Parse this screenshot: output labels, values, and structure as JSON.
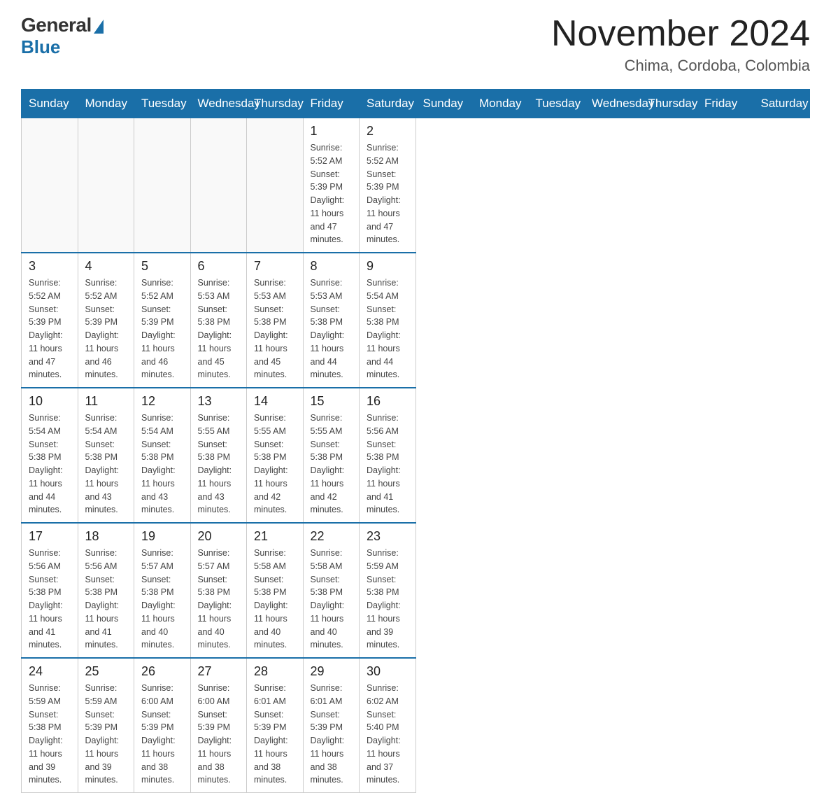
{
  "header": {
    "logo": {
      "general": "General",
      "blue": "Blue"
    },
    "title": "November 2024",
    "location": "Chima, Cordoba, Colombia"
  },
  "days_of_week": [
    "Sunday",
    "Monday",
    "Tuesday",
    "Wednesday",
    "Thursday",
    "Friday",
    "Saturday"
  ],
  "weeks": [
    [
      {
        "day": "",
        "info": ""
      },
      {
        "day": "",
        "info": ""
      },
      {
        "day": "",
        "info": ""
      },
      {
        "day": "",
        "info": ""
      },
      {
        "day": "",
        "info": ""
      },
      {
        "day": "1",
        "info": "Sunrise: 5:52 AM\nSunset: 5:39 PM\nDaylight: 11 hours\nand 47 minutes."
      },
      {
        "day": "2",
        "info": "Sunrise: 5:52 AM\nSunset: 5:39 PM\nDaylight: 11 hours\nand 47 minutes."
      }
    ],
    [
      {
        "day": "3",
        "info": "Sunrise: 5:52 AM\nSunset: 5:39 PM\nDaylight: 11 hours\nand 47 minutes."
      },
      {
        "day": "4",
        "info": "Sunrise: 5:52 AM\nSunset: 5:39 PM\nDaylight: 11 hours\nand 46 minutes."
      },
      {
        "day": "5",
        "info": "Sunrise: 5:52 AM\nSunset: 5:39 PM\nDaylight: 11 hours\nand 46 minutes."
      },
      {
        "day": "6",
        "info": "Sunrise: 5:53 AM\nSunset: 5:38 PM\nDaylight: 11 hours\nand 45 minutes."
      },
      {
        "day": "7",
        "info": "Sunrise: 5:53 AM\nSunset: 5:38 PM\nDaylight: 11 hours\nand 45 minutes."
      },
      {
        "day": "8",
        "info": "Sunrise: 5:53 AM\nSunset: 5:38 PM\nDaylight: 11 hours\nand 44 minutes."
      },
      {
        "day": "9",
        "info": "Sunrise: 5:54 AM\nSunset: 5:38 PM\nDaylight: 11 hours\nand 44 minutes."
      }
    ],
    [
      {
        "day": "10",
        "info": "Sunrise: 5:54 AM\nSunset: 5:38 PM\nDaylight: 11 hours\nand 44 minutes."
      },
      {
        "day": "11",
        "info": "Sunrise: 5:54 AM\nSunset: 5:38 PM\nDaylight: 11 hours\nand 43 minutes."
      },
      {
        "day": "12",
        "info": "Sunrise: 5:54 AM\nSunset: 5:38 PM\nDaylight: 11 hours\nand 43 minutes."
      },
      {
        "day": "13",
        "info": "Sunrise: 5:55 AM\nSunset: 5:38 PM\nDaylight: 11 hours\nand 43 minutes."
      },
      {
        "day": "14",
        "info": "Sunrise: 5:55 AM\nSunset: 5:38 PM\nDaylight: 11 hours\nand 42 minutes."
      },
      {
        "day": "15",
        "info": "Sunrise: 5:55 AM\nSunset: 5:38 PM\nDaylight: 11 hours\nand 42 minutes."
      },
      {
        "day": "16",
        "info": "Sunrise: 5:56 AM\nSunset: 5:38 PM\nDaylight: 11 hours\nand 41 minutes."
      }
    ],
    [
      {
        "day": "17",
        "info": "Sunrise: 5:56 AM\nSunset: 5:38 PM\nDaylight: 11 hours\nand 41 minutes."
      },
      {
        "day": "18",
        "info": "Sunrise: 5:56 AM\nSunset: 5:38 PM\nDaylight: 11 hours\nand 41 minutes."
      },
      {
        "day": "19",
        "info": "Sunrise: 5:57 AM\nSunset: 5:38 PM\nDaylight: 11 hours\nand 40 minutes."
      },
      {
        "day": "20",
        "info": "Sunrise: 5:57 AM\nSunset: 5:38 PM\nDaylight: 11 hours\nand 40 minutes."
      },
      {
        "day": "21",
        "info": "Sunrise: 5:58 AM\nSunset: 5:38 PM\nDaylight: 11 hours\nand 40 minutes."
      },
      {
        "day": "22",
        "info": "Sunrise: 5:58 AM\nSunset: 5:38 PM\nDaylight: 11 hours\nand 40 minutes."
      },
      {
        "day": "23",
        "info": "Sunrise: 5:59 AM\nSunset: 5:38 PM\nDaylight: 11 hours\nand 39 minutes."
      }
    ],
    [
      {
        "day": "24",
        "info": "Sunrise: 5:59 AM\nSunset: 5:38 PM\nDaylight: 11 hours\nand 39 minutes."
      },
      {
        "day": "25",
        "info": "Sunrise: 5:59 AM\nSunset: 5:39 PM\nDaylight: 11 hours\nand 39 minutes."
      },
      {
        "day": "26",
        "info": "Sunrise: 6:00 AM\nSunset: 5:39 PM\nDaylight: 11 hours\nand 38 minutes."
      },
      {
        "day": "27",
        "info": "Sunrise: 6:00 AM\nSunset: 5:39 PM\nDaylight: 11 hours\nand 38 minutes."
      },
      {
        "day": "28",
        "info": "Sunrise: 6:01 AM\nSunset: 5:39 PM\nDaylight: 11 hours\nand 38 minutes."
      },
      {
        "day": "29",
        "info": "Sunrise: 6:01 AM\nSunset: 5:39 PM\nDaylight: 11 hours\nand 38 minutes."
      },
      {
        "day": "30",
        "info": "Sunrise: 6:02 AM\nSunset: 5:40 PM\nDaylight: 11 hours\nand 37 minutes."
      }
    ]
  ]
}
